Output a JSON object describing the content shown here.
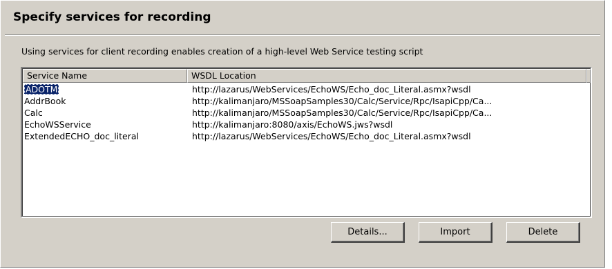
{
  "dialog": {
    "title": "Specify services for recording",
    "description": "Using services for client recording enables creation of a high-level Web Service testing script"
  },
  "table": {
    "columns": [
      "Service Name",
      "WSDL Location"
    ],
    "rows": [
      {
        "name": "ADOTM",
        "wsdl": "http://lazarus/WebServices/EchoWS/Echo_doc_Literal.asmx?wsdl",
        "selected": true
      },
      {
        "name": "AddrBook",
        "wsdl": "http://kalimanjaro/MSSoapSamples30/Calc/Service/Rpc/IsapiCpp/Ca...",
        "selected": false
      },
      {
        "name": "Calc",
        "wsdl": "http://kalimanjaro/MSSoapSamples30/Calc/Service/Rpc/IsapiCpp/Ca...",
        "selected": false
      },
      {
        "name": "EchoWSService",
        "wsdl": "http://kalimanjaro:8080/axis/EchoWS.jws?wsdl",
        "selected": false
      },
      {
        "name": "ExtendedECHO_doc_literal",
        "wsdl": "http://lazarus/WebServices/EchoWS/Echo_doc_Literal.asmx?wsdl",
        "selected": false
      }
    ]
  },
  "buttons": {
    "details": "Details...",
    "import": "Import",
    "delete": "Delete"
  },
  "colors": {
    "dialog_bg": "#d4d0c8",
    "selection_bg": "#0a246a",
    "selection_fg": "#ffffff"
  }
}
